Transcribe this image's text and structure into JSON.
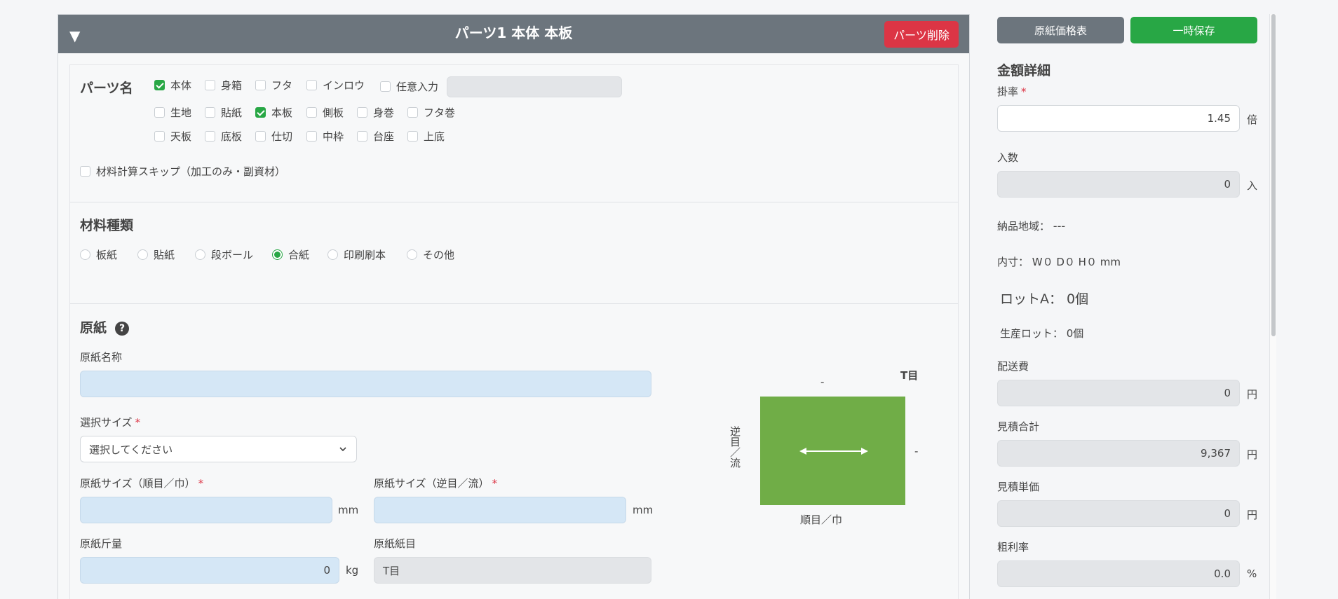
{
  "part": {
    "title": "パーツ1  本体 本板",
    "delete_label": "パーツ削除",
    "collapse_icon": "▼",
    "name_heading": "パーツ名",
    "name_options": [
      {
        "label": "本体",
        "checked": true
      },
      {
        "label": "身箱",
        "checked": false
      },
      {
        "label": "フタ",
        "checked": false
      },
      {
        "label": "インロウ",
        "checked": false
      },
      {
        "label": "任意入力",
        "checked": false
      },
      {
        "label": "生地",
        "checked": false
      },
      {
        "label": "貼紙",
        "checked": false
      },
      {
        "label": "本板",
        "checked": true
      },
      {
        "label": "側板",
        "checked": false
      },
      {
        "label": "身巻",
        "checked": false
      },
      {
        "label": "フタ巻",
        "checked": false
      },
      {
        "label": "天板",
        "checked": false
      },
      {
        "label": "底板",
        "checked": false
      },
      {
        "label": "仕切",
        "checked": false
      },
      {
        "label": "中枠",
        "checked": false
      },
      {
        "label": "台座",
        "checked": false
      },
      {
        "label": "上底",
        "checked": false
      }
    ],
    "free_input_value": "",
    "skip_label": "材料計算スキップ（加工のみ・副資材）",
    "skip_checked": false
  },
  "material": {
    "heading": "材料種類",
    "options": [
      {
        "label": "板紙",
        "selected": false
      },
      {
        "label": "貼紙",
        "selected": false
      },
      {
        "label": "段ボール",
        "selected": false
      },
      {
        "label": "合紙",
        "selected": true
      },
      {
        "label": "印刷刷本",
        "selected": false
      },
      {
        "label": "その他",
        "selected": false
      }
    ]
  },
  "paper": {
    "heading": "原紙",
    "help_icon": "?",
    "name_label": "原紙名称",
    "name_value": "",
    "size_label": "選択サイズ",
    "size_value": "選択してください",
    "width_label": "原紙サイズ（順目／巾）",
    "width_value": "",
    "length_label": "原紙サイズ（逆目／流）",
    "length_value": "",
    "unit_mm": "mm",
    "weight_label": "原紙斤量",
    "weight_value": "0",
    "unit_kg": "kg",
    "grain_label": "原紙紙目",
    "grain_value": "T目"
  },
  "diagram": {
    "grain": "T目",
    "top_dash": "-",
    "right_dash": "-",
    "side_label": "逆目／流",
    "bottom_label": "順目／巾",
    "fill": "#70ad47"
  },
  "sidebar": {
    "price_table_label": "原紙価格表",
    "save_label": "一時保存",
    "detail_heading": "金額詳細",
    "rate_label": "掛率",
    "rate_value": "1.45",
    "rate_unit": "倍",
    "qty_label": "入数",
    "qty_value": "0",
    "qty_unit": "入",
    "region_label": "納品地域：",
    "region_value": "---",
    "inner_size": "内寸： W０  D０  H０   mm",
    "lot_a": "ロットA：  0個",
    "prod_lot": "生産ロット：  0個",
    "shipping_label": "配送費",
    "shipping_value": "0",
    "yen": "円",
    "total_label": "見積合計",
    "total_value": "9,367",
    "unit_price_label": "見積単価",
    "unit_price_value": "0",
    "margin_label": "粗利率",
    "margin_value": "0.0",
    "percent": "%"
  },
  "colors": {
    "header": "#6c757d",
    "danger": "#dc3545",
    "success": "#28a745",
    "secondary": "#6c757d"
  }
}
